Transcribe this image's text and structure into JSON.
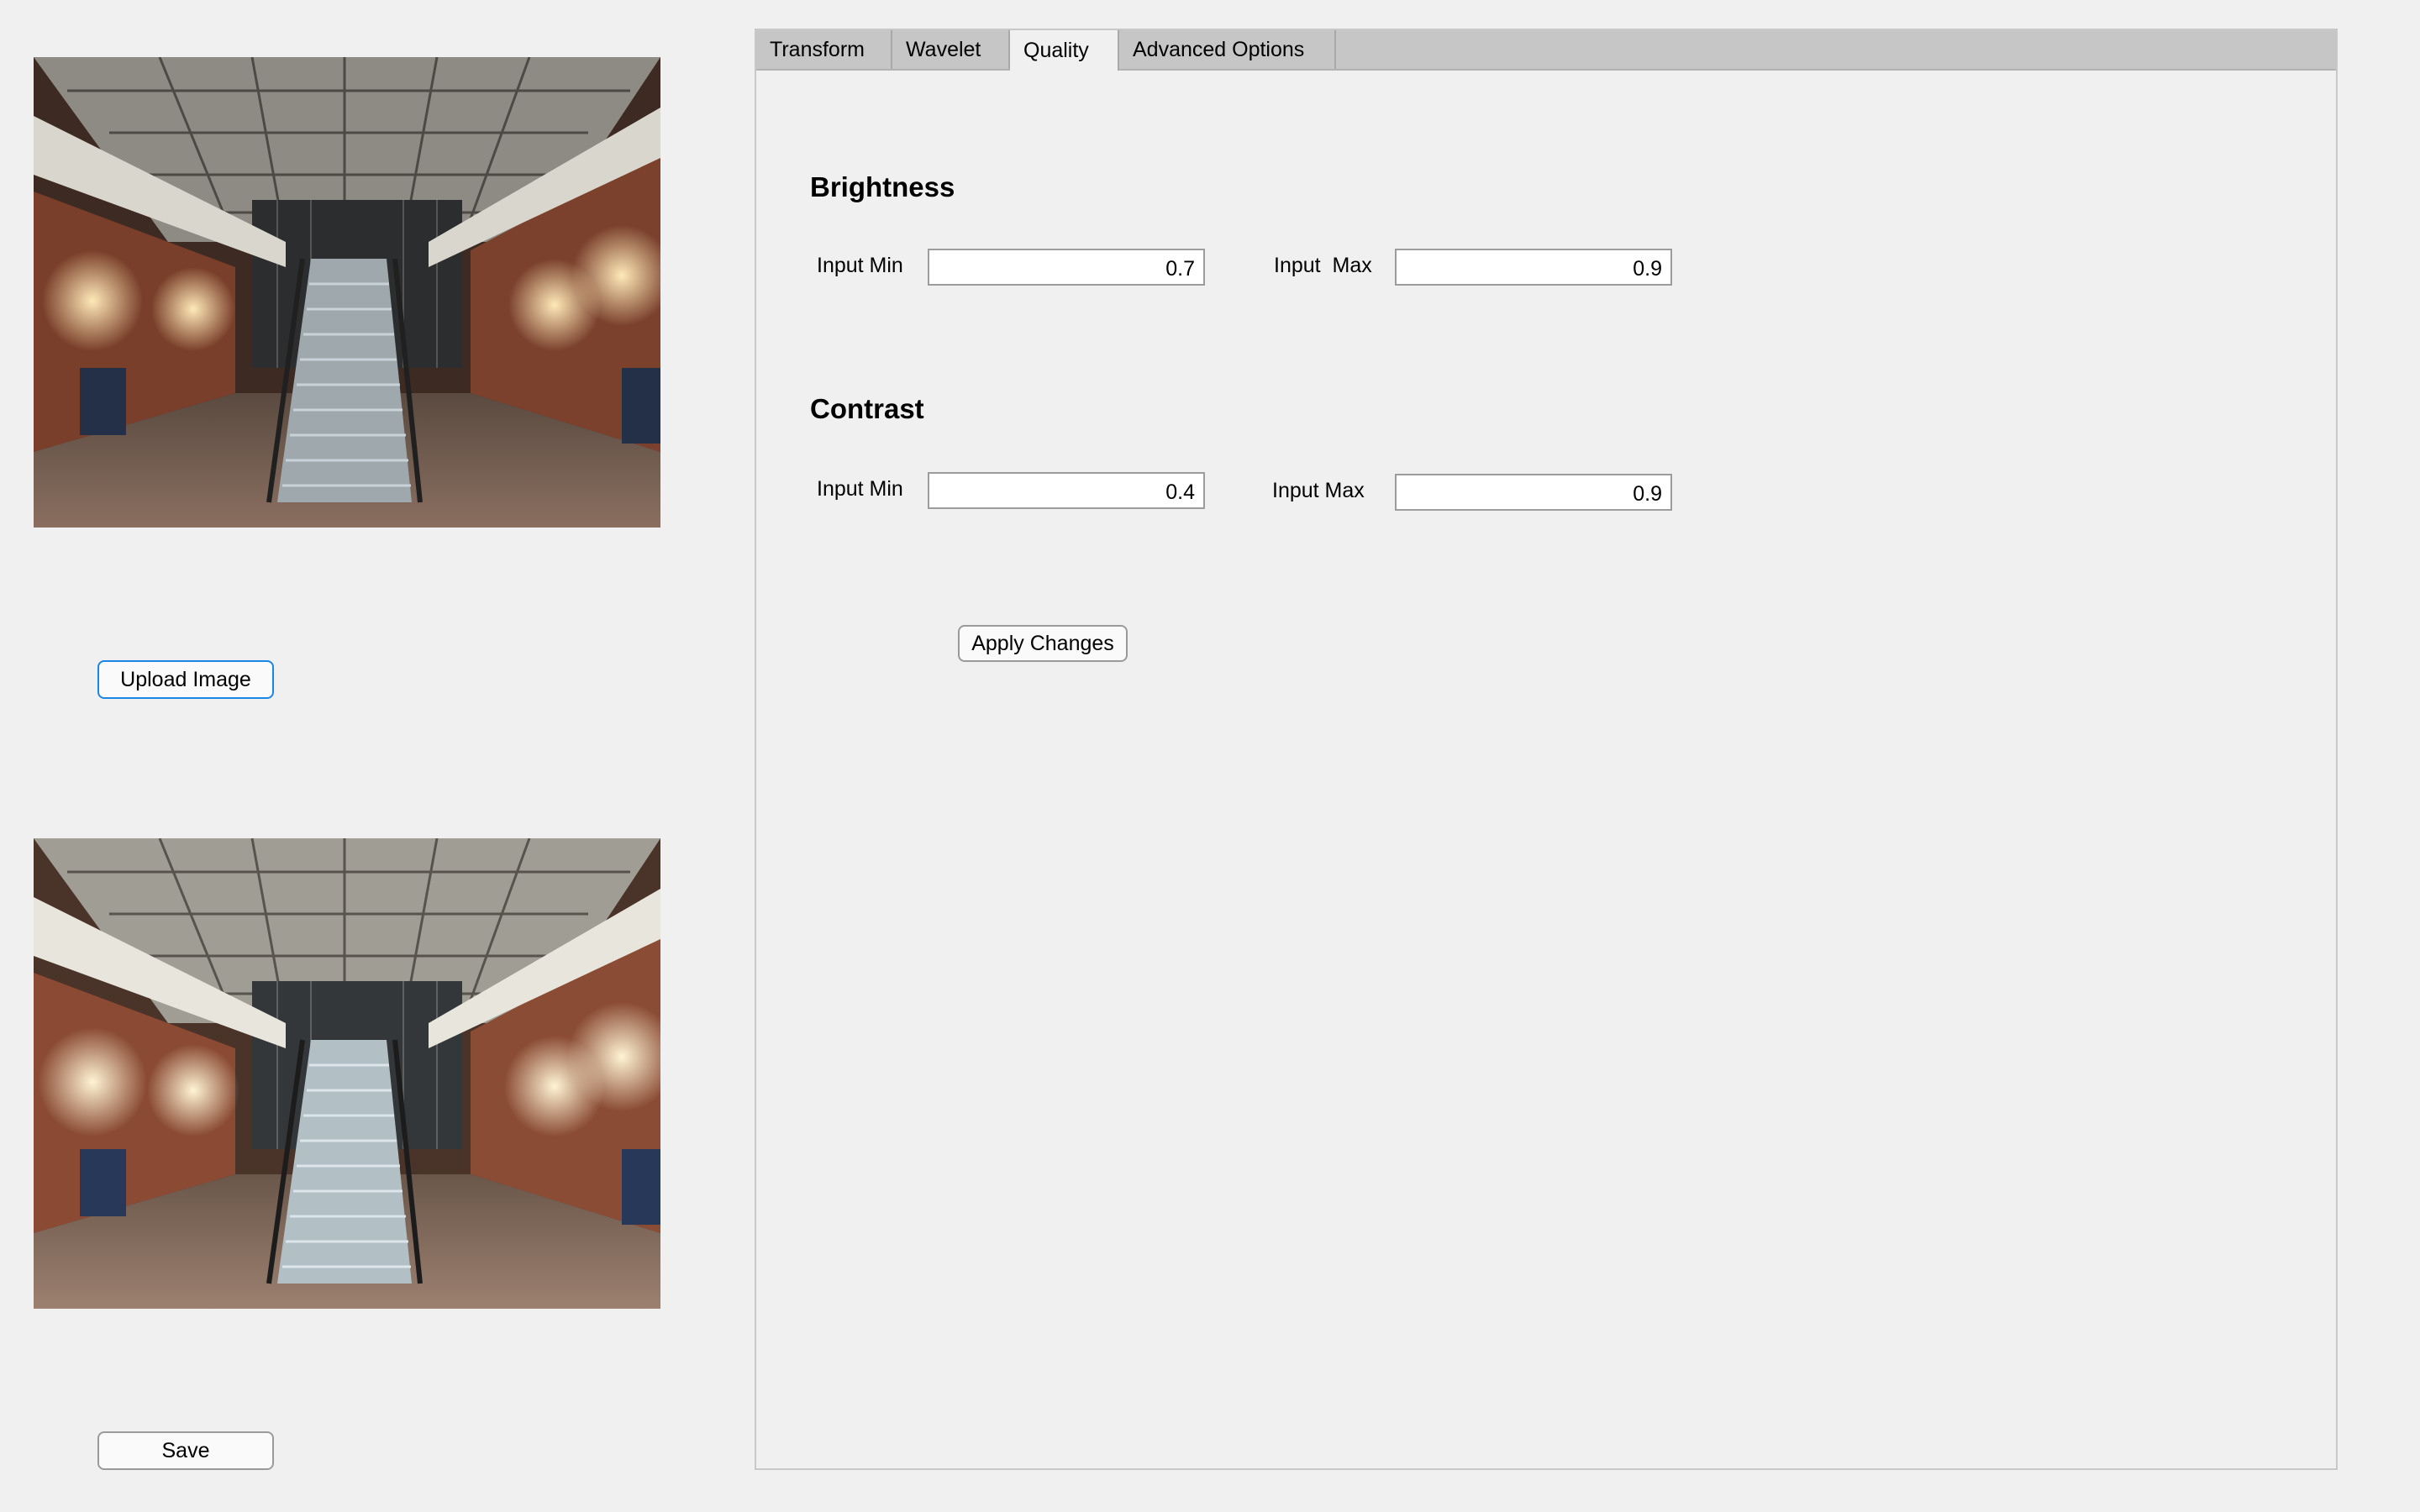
{
  "images": {
    "original": "staircase-atrium-photo",
    "result": "staircase-atrium-photo"
  },
  "sidebar": {
    "upload_label": "Upload Image",
    "save_label": "Save"
  },
  "tabs": [
    {
      "label": "Transform"
    },
    {
      "label": "Wavelet"
    },
    {
      "label": "Quality",
      "active": true
    },
    {
      "label": "Advanced Options"
    }
  ],
  "quality": {
    "brightness": {
      "title": "Brightness",
      "min_label": "Input Min",
      "min_value": "0.7",
      "max_label": "Input  Max",
      "max_value": "0.9"
    },
    "contrast": {
      "title": "Contrast",
      "min_label": "Input Min",
      "min_value": "0.4",
      "max_label": "Input Max",
      "max_value": "0.9"
    },
    "apply_label": "Apply Changes"
  },
  "colors": {
    "focus_accent": "#1a86e6",
    "tabbar": "#c6c6c6",
    "background": "#f0f0f0"
  }
}
